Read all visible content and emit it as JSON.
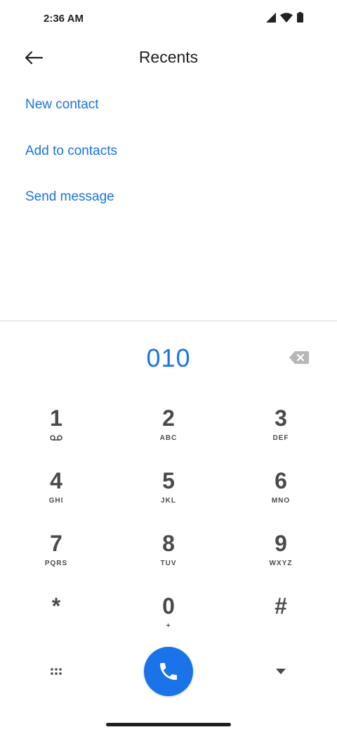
{
  "status": {
    "time": "2:36 AM"
  },
  "header": {
    "title": "Recents"
  },
  "actions": [
    {
      "label": "New contact"
    },
    {
      "label": "Add to contacts"
    },
    {
      "label": "Send message"
    }
  ],
  "dialpad": {
    "entered": "010",
    "keys": [
      {
        "num": "1",
        "letters": ""
      },
      {
        "num": "2",
        "letters": "ABC"
      },
      {
        "num": "3",
        "letters": "DEF"
      },
      {
        "num": "4",
        "letters": "GHI"
      },
      {
        "num": "5",
        "letters": "JKL"
      },
      {
        "num": "6",
        "letters": "MNO"
      },
      {
        "num": "7",
        "letters": "PQRS"
      },
      {
        "num": "8",
        "letters": "TUV"
      },
      {
        "num": "9",
        "letters": "WXYZ"
      },
      {
        "num": "*",
        "letters": ""
      },
      {
        "num": "0",
        "letters": "+"
      },
      {
        "num": "#",
        "letters": ""
      }
    ]
  },
  "colors": {
    "accent": "#1a73e8",
    "key_text": "#4a4a4a"
  },
  "icons": [
    "signal-icon",
    "wifi-icon",
    "battery-icon",
    "back-arrow-icon",
    "backspace-icon",
    "voicemail-icon",
    "dialpad-grid-icon",
    "phone-icon",
    "dropdown-arrow-icon"
  ]
}
